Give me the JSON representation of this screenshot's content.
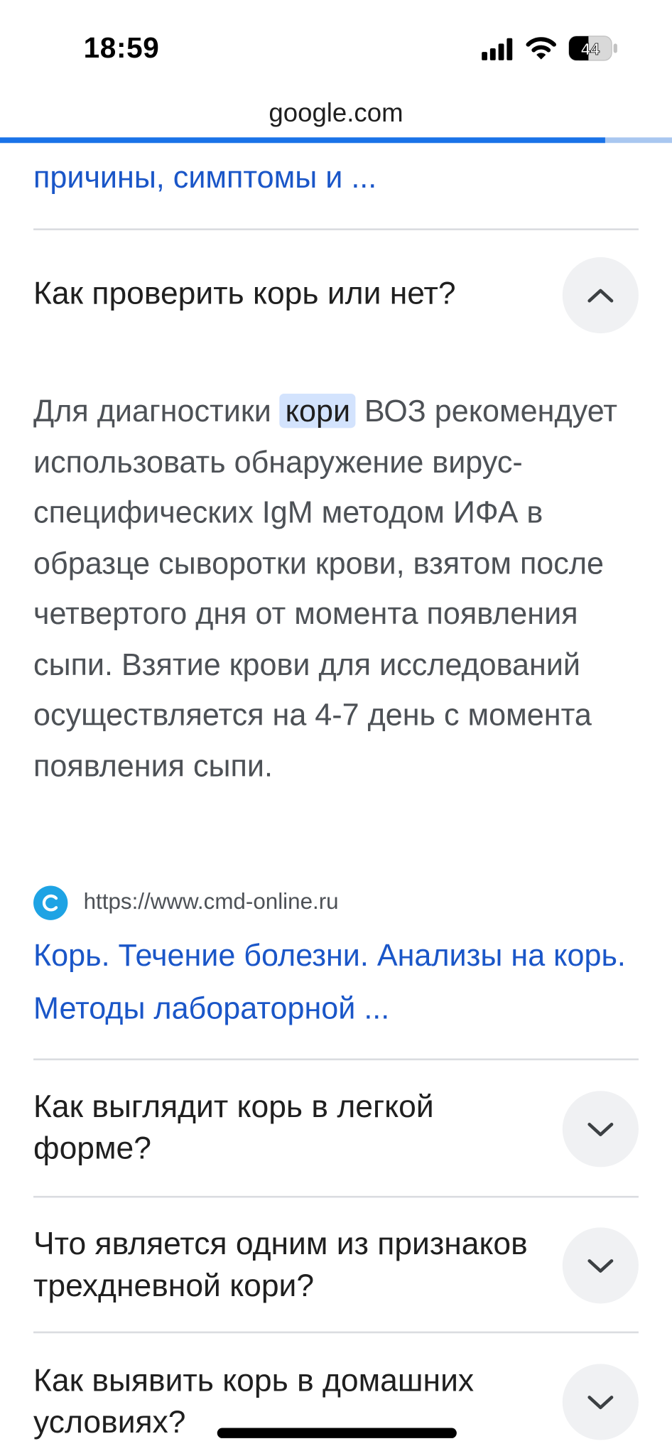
{
  "status_bar": {
    "time": "18:59",
    "battery": "44"
  },
  "browser": {
    "url": "google.com",
    "load_progress": 0.9
  },
  "content": {
    "previous_result_title": "причины, симптомы и ...",
    "expanded_question": {
      "question": "Как проверить корь или нет?",
      "answer_before": "Для диагностики",
      "answer_highlight": "кори",
      "answer_after": "ВОЗ рекомендует использовать обнаружение вирус-специфических IgM методом ИФА в образце сыворотки крови, взятом после четвертого дня от момента появления сыпи. Взятие крови для исследований осуществляется на 4-7 день с момента появления сыпи.",
      "source_url": "https://www.cmd-online.ru",
      "source_title": "Корь. Течение болезни. Анализы на корь. Методы лабораторной ..."
    },
    "collapsed_questions": [
      {
        "question": "Как выглядит корь в легкой форме?"
      },
      {
        "question": "Что является одним из признаков трехдневной кори?"
      },
      {
        "question": "Как выявить корь в домашних условиях?"
      }
    ]
  },
  "colors": {
    "link": "#1a56c8",
    "progress": "#1a73e8",
    "highlight": "#d3e3fd",
    "favicon": "#1ea3e4"
  },
  "icons": {
    "expanded_toggle": "chevron-up-icon",
    "collapsed_toggle": "chevron-down-icon",
    "favicon": "cmd-favicon-icon"
  }
}
